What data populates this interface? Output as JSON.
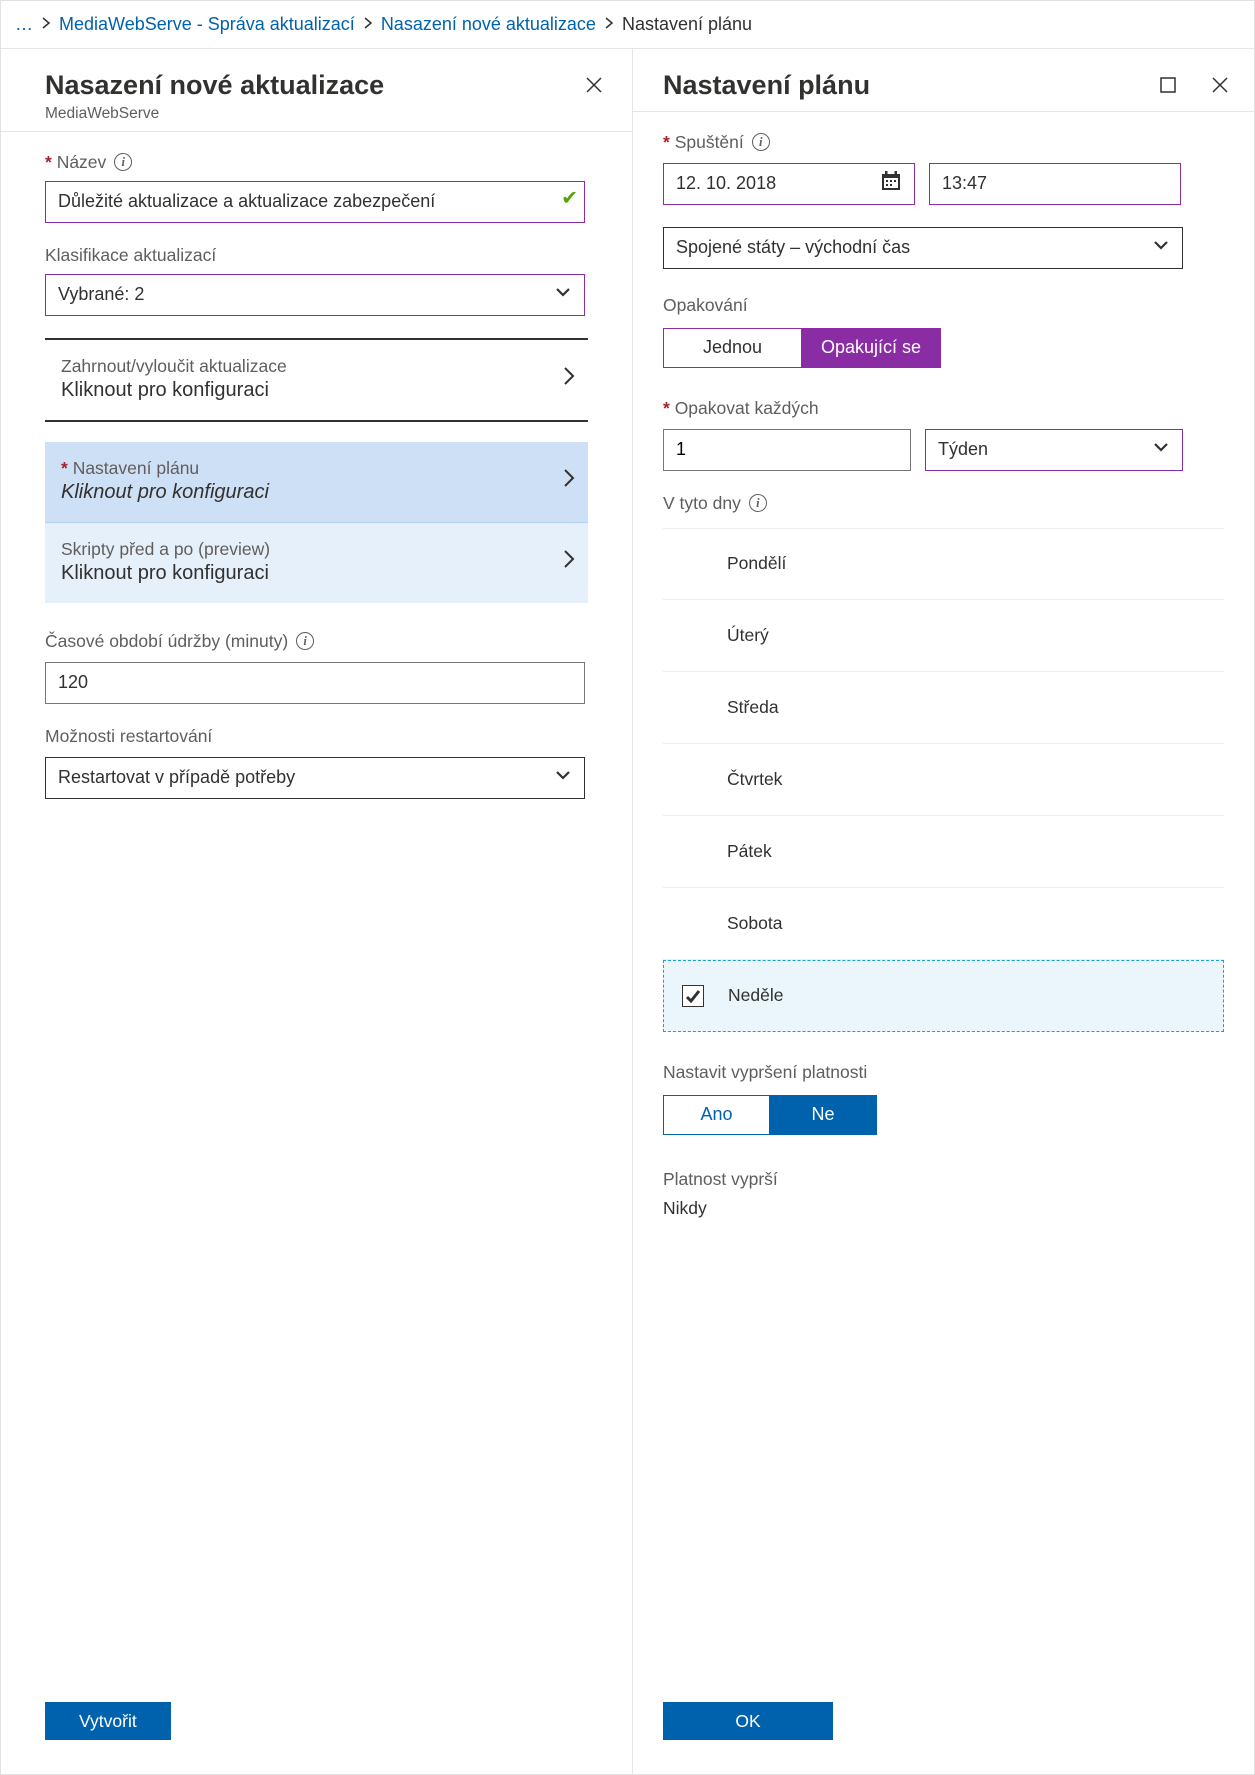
{
  "breadcrumb": {
    "ellipsis": "…",
    "items": [
      "MediaWebServe - Správa aktualizací",
      "Nasazení nové aktualizace",
      "Nastavení plánu"
    ]
  },
  "left": {
    "title": "Nasazení nové aktualizace",
    "subtitle": "MediaWebServe",
    "name_label": "Název",
    "name_value": "Důležité aktualizace a aktualizace zabezpečení",
    "classif_label": "Klasifikace aktualizací",
    "classif_value": "Vybrané: 2",
    "nav": {
      "incexc_label": "Zahrnout/vyloučit aktualizace",
      "incexc_val": "Kliknout pro konfiguraci",
      "sched_label": "Nastavení plánu",
      "sched_val": "Kliknout pro konfiguraci",
      "scripts_label": "Skripty před a po (preview)",
      "scripts_val": "Kliknout pro konfiguraci"
    },
    "maint_label": "Časové období údržby (minuty)",
    "maint_value": "120",
    "reboot_label": "Možnosti restartování",
    "reboot_value": "Restartovat v případě potřeby",
    "create_btn": "Vytvořit"
  },
  "right": {
    "title": "Nastavení plánu",
    "start_label": "Spuštění",
    "date_value": "12. 10. 2018",
    "time_value": "13:47",
    "tz_value": "Spojené státy – východní čas",
    "repeat_label": "Opakování",
    "repeat_once": "Jednou",
    "repeat_recurring": "Opakující se",
    "every_label": "Opakovat každých",
    "every_value": "1",
    "every_unit": "Týden",
    "days_label": "V tyto dny",
    "days": [
      "Pondělí",
      "Úterý",
      "Středa",
      "Čtvrtek",
      "Pátek",
      "Sobota",
      "Neděle"
    ],
    "day_selected_index": 6,
    "expire_label": "Nastavit vypršení platnosti",
    "expire_yes": "Ano",
    "expire_no": "Ne",
    "validity_label": "Platnost vyprší",
    "validity_value": "Nikdy",
    "ok_btn": "OK"
  }
}
